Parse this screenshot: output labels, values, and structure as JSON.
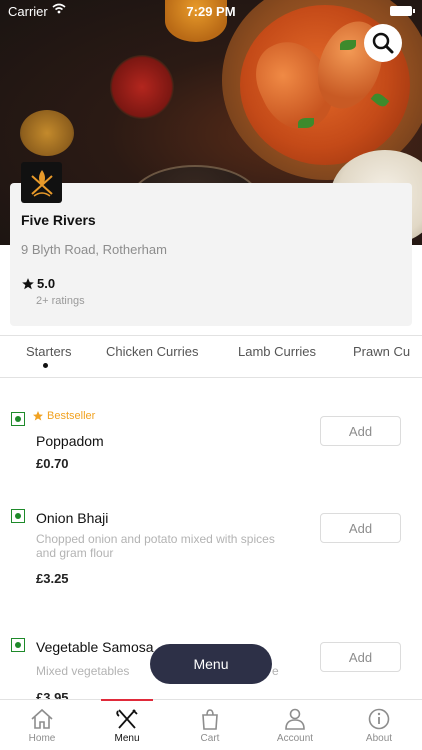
{
  "status_bar": {
    "carrier": "Carrier",
    "time": "7:29 PM"
  },
  "restaurant": {
    "name": "Five Rivers",
    "address": "9 Blyth Road, Rotherham",
    "rating": "5.0",
    "ratings_count": "2+ ratings"
  },
  "tabs": [
    {
      "label": "Starters",
      "active": true
    },
    {
      "label": "Chicken Curries"
    },
    {
      "label": "Lamb Curries"
    },
    {
      "label": "Prawn Cu"
    }
  ],
  "items": [
    {
      "badge": "Bestseller",
      "name": "Poppadom",
      "description": "",
      "price": "£0.70",
      "add_label": "Add"
    },
    {
      "name": "Onion Bhaji",
      "description": "Chopped onion and potato mixed with spices and gram flour",
      "price": "£3.25",
      "add_label": "Add"
    },
    {
      "name": "Vegetable Samosa",
      "description": "Mixed vegetables",
      "description_tail": "e",
      "price": "£3.95",
      "add_label": "Add"
    }
  ],
  "menu_button": "Menu",
  "bottom_nav": [
    {
      "label": "Home",
      "icon": "home-icon"
    },
    {
      "label": "Menu",
      "icon": "fork-knife-icon",
      "active": true
    },
    {
      "label": "Cart",
      "icon": "bag-icon"
    },
    {
      "label": "Account",
      "icon": "user-icon"
    },
    {
      "label": "About",
      "icon": "info-icon"
    }
  ],
  "colors": {
    "accent": "#e02a3a",
    "veg": "#1e8a2a",
    "bestseller": "#f1a221",
    "fab": "#2d3047"
  }
}
